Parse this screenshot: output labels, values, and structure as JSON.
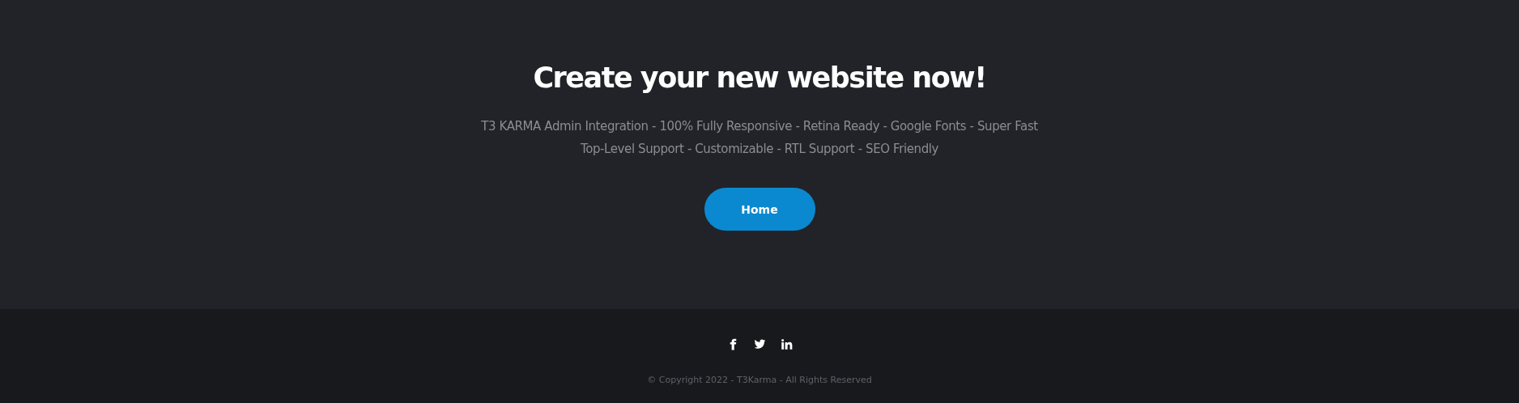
{
  "hero": {
    "title": "Create your new website now!",
    "description": "T3 KARMA Admin Integration - 100% Fully Responsive - Retina Ready - Google Fonts - Super Fast Top-Level Support - Customizable - RTL Support - SEO Friendly",
    "button": "Home"
  },
  "footer": {
    "social": [
      {
        "kind": "facebook"
      },
      {
        "kind": "twitter"
      },
      {
        "kind": "linkedin"
      }
    ],
    "copyright": "© Copyright 2022 - T3Karma - All Rights Reserved"
  }
}
